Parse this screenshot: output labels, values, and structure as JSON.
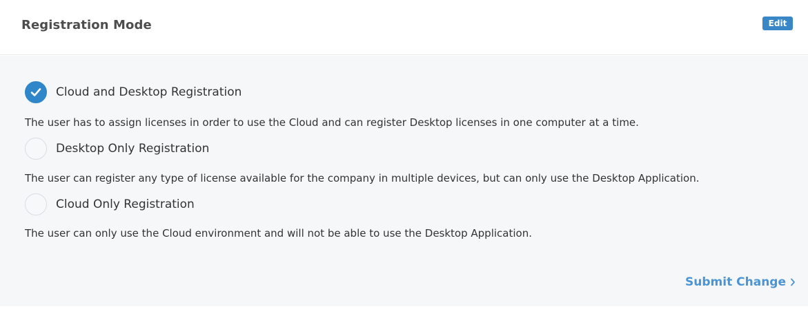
{
  "header": {
    "title": "Registration Mode",
    "edit_label": "Edit"
  },
  "options": [
    {
      "label": "Cloud and Desktop Registration",
      "description": "The user has to assign licenses in order to use the Cloud and can register Desktop licenses in one computer at a time.",
      "selected": true
    },
    {
      "label": "Desktop Only Registration",
      "description": "The user can register any type of license available for the company in multiple devices, but can only use the Desktop Application.",
      "selected": false
    },
    {
      "label": "Cloud Only Registration",
      "description": "The user can only use the Cloud environment and will not be able to use the Desktop Application.",
      "selected": false
    }
  ],
  "footer": {
    "submit_label": "Submit Change"
  },
  "colors": {
    "accent": "#2f86c8",
    "link": "#4a95d6",
    "edit_badge": "#3a87c8",
    "body_bg": "#f6f7f9"
  },
  "icons": {
    "selected": "checkmark-icon",
    "submit": "chevron-right-icon"
  }
}
